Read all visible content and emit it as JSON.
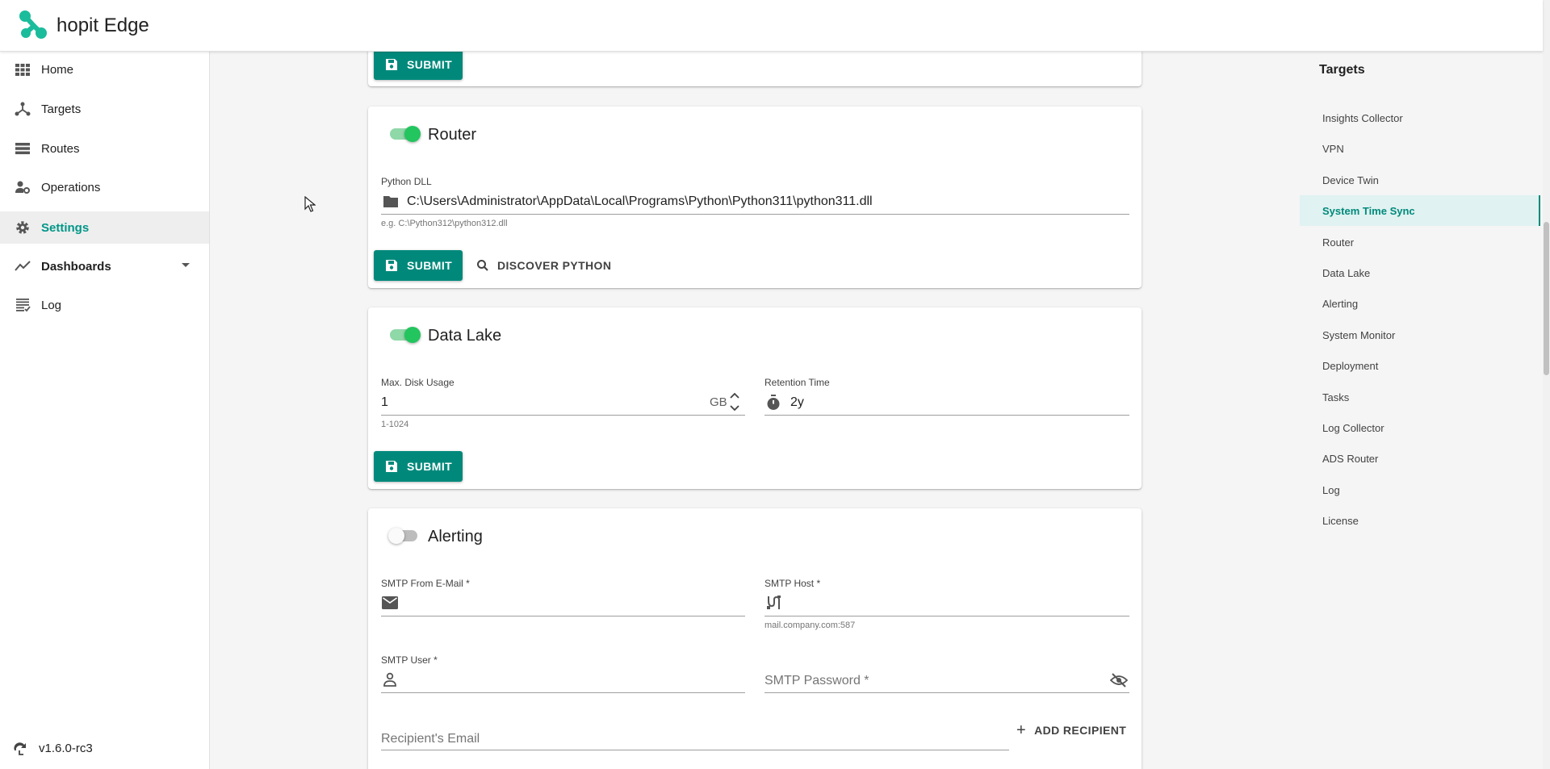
{
  "app": {
    "title": "hopit Edge",
    "brand_color": "#1abc9c",
    "accent_color": "#00897b"
  },
  "sidebar": {
    "items": [
      {
        "label": "Home",
        "icon": "grid-icon"
      },
      {
        "label": "Targets",
        "icon": "network-icon"
      },
      {
        "label": "Routes",
        "icon": "routes-icon"
      },
      {
        "label": "Operations",
        "icon": "user-gear-icon"
      },
      {
        "label": "Settings",
        "icon": "gear-icon",
        "active": true
      },
      {
        "label": "Dashboards",
        "icon": "trend-icon",
        "expandable": true
      },
      {
        "label": "Log",
        "icon": "log-icon"
      }
    ],
    "version": "v1.6.0-rc3"
  },
  "cards": {
    "top": {
      "submit_label": "SUBMIT"
    },
    "router": {
      "title": "Router",
      "enabled": true,
      "python_dll": {
        "label": "Python DLL",
        "value": "C:\\Users\\Administrator\\AppData\\Local\\Programs\\Python\\Python311\\python311.dll",
        "hint": "e.g. C:\\Python312\\python312.dll"
      },
      "submit_label": "SUBMIT",
      "discover_label": "DISCOVER PYTHON"
    },
    "datalake": {
      "title": "Data Lake",
      "enabled": true,
      "max_disk": {
        "label": "Max. Disk Usage",
        "value": "1",
        "unit": "GB",
        "hint": "1-1024"
      },
      "retention": {
        "label": "Retention Time",
        "value": "2y"
      },
      "submit_label": "SUBMIT"
    },
    "alerting": {
      "title": "Alerting",
      "enabled": false,
      "smtp_from": {
        "label": "SMTP From E-Mail *"
      },
      "smtp_host": {
        "label": "SMTP Host *",
        "hint": "mail.company.com:587"
      },
      "smtp_user": {
        "label": "SMTP User *"
      },
      "smtp_password": {
        "placeholder": "SMTP Password *"
      },
      "recipient": {
        "placeholder": "Recipient's Email"
      },
      "add_recipient_label": "ADD RECIPIENT"
    }
  },
  "toc": {
    "title": "Targets",
    "items": [
      "Insights Collector",
      "VPN",
      "Device Twin",
      "System Time Sync",
      "Router",
      "Data Lake",
      "Alerting",
      "System Monitor",
      "Deployment",
      "Tasks",
      "Log Collector",
      "ADS Router",
      "Log",
      "License"
    ],
    "active": "System Time Sync"
  }
}
